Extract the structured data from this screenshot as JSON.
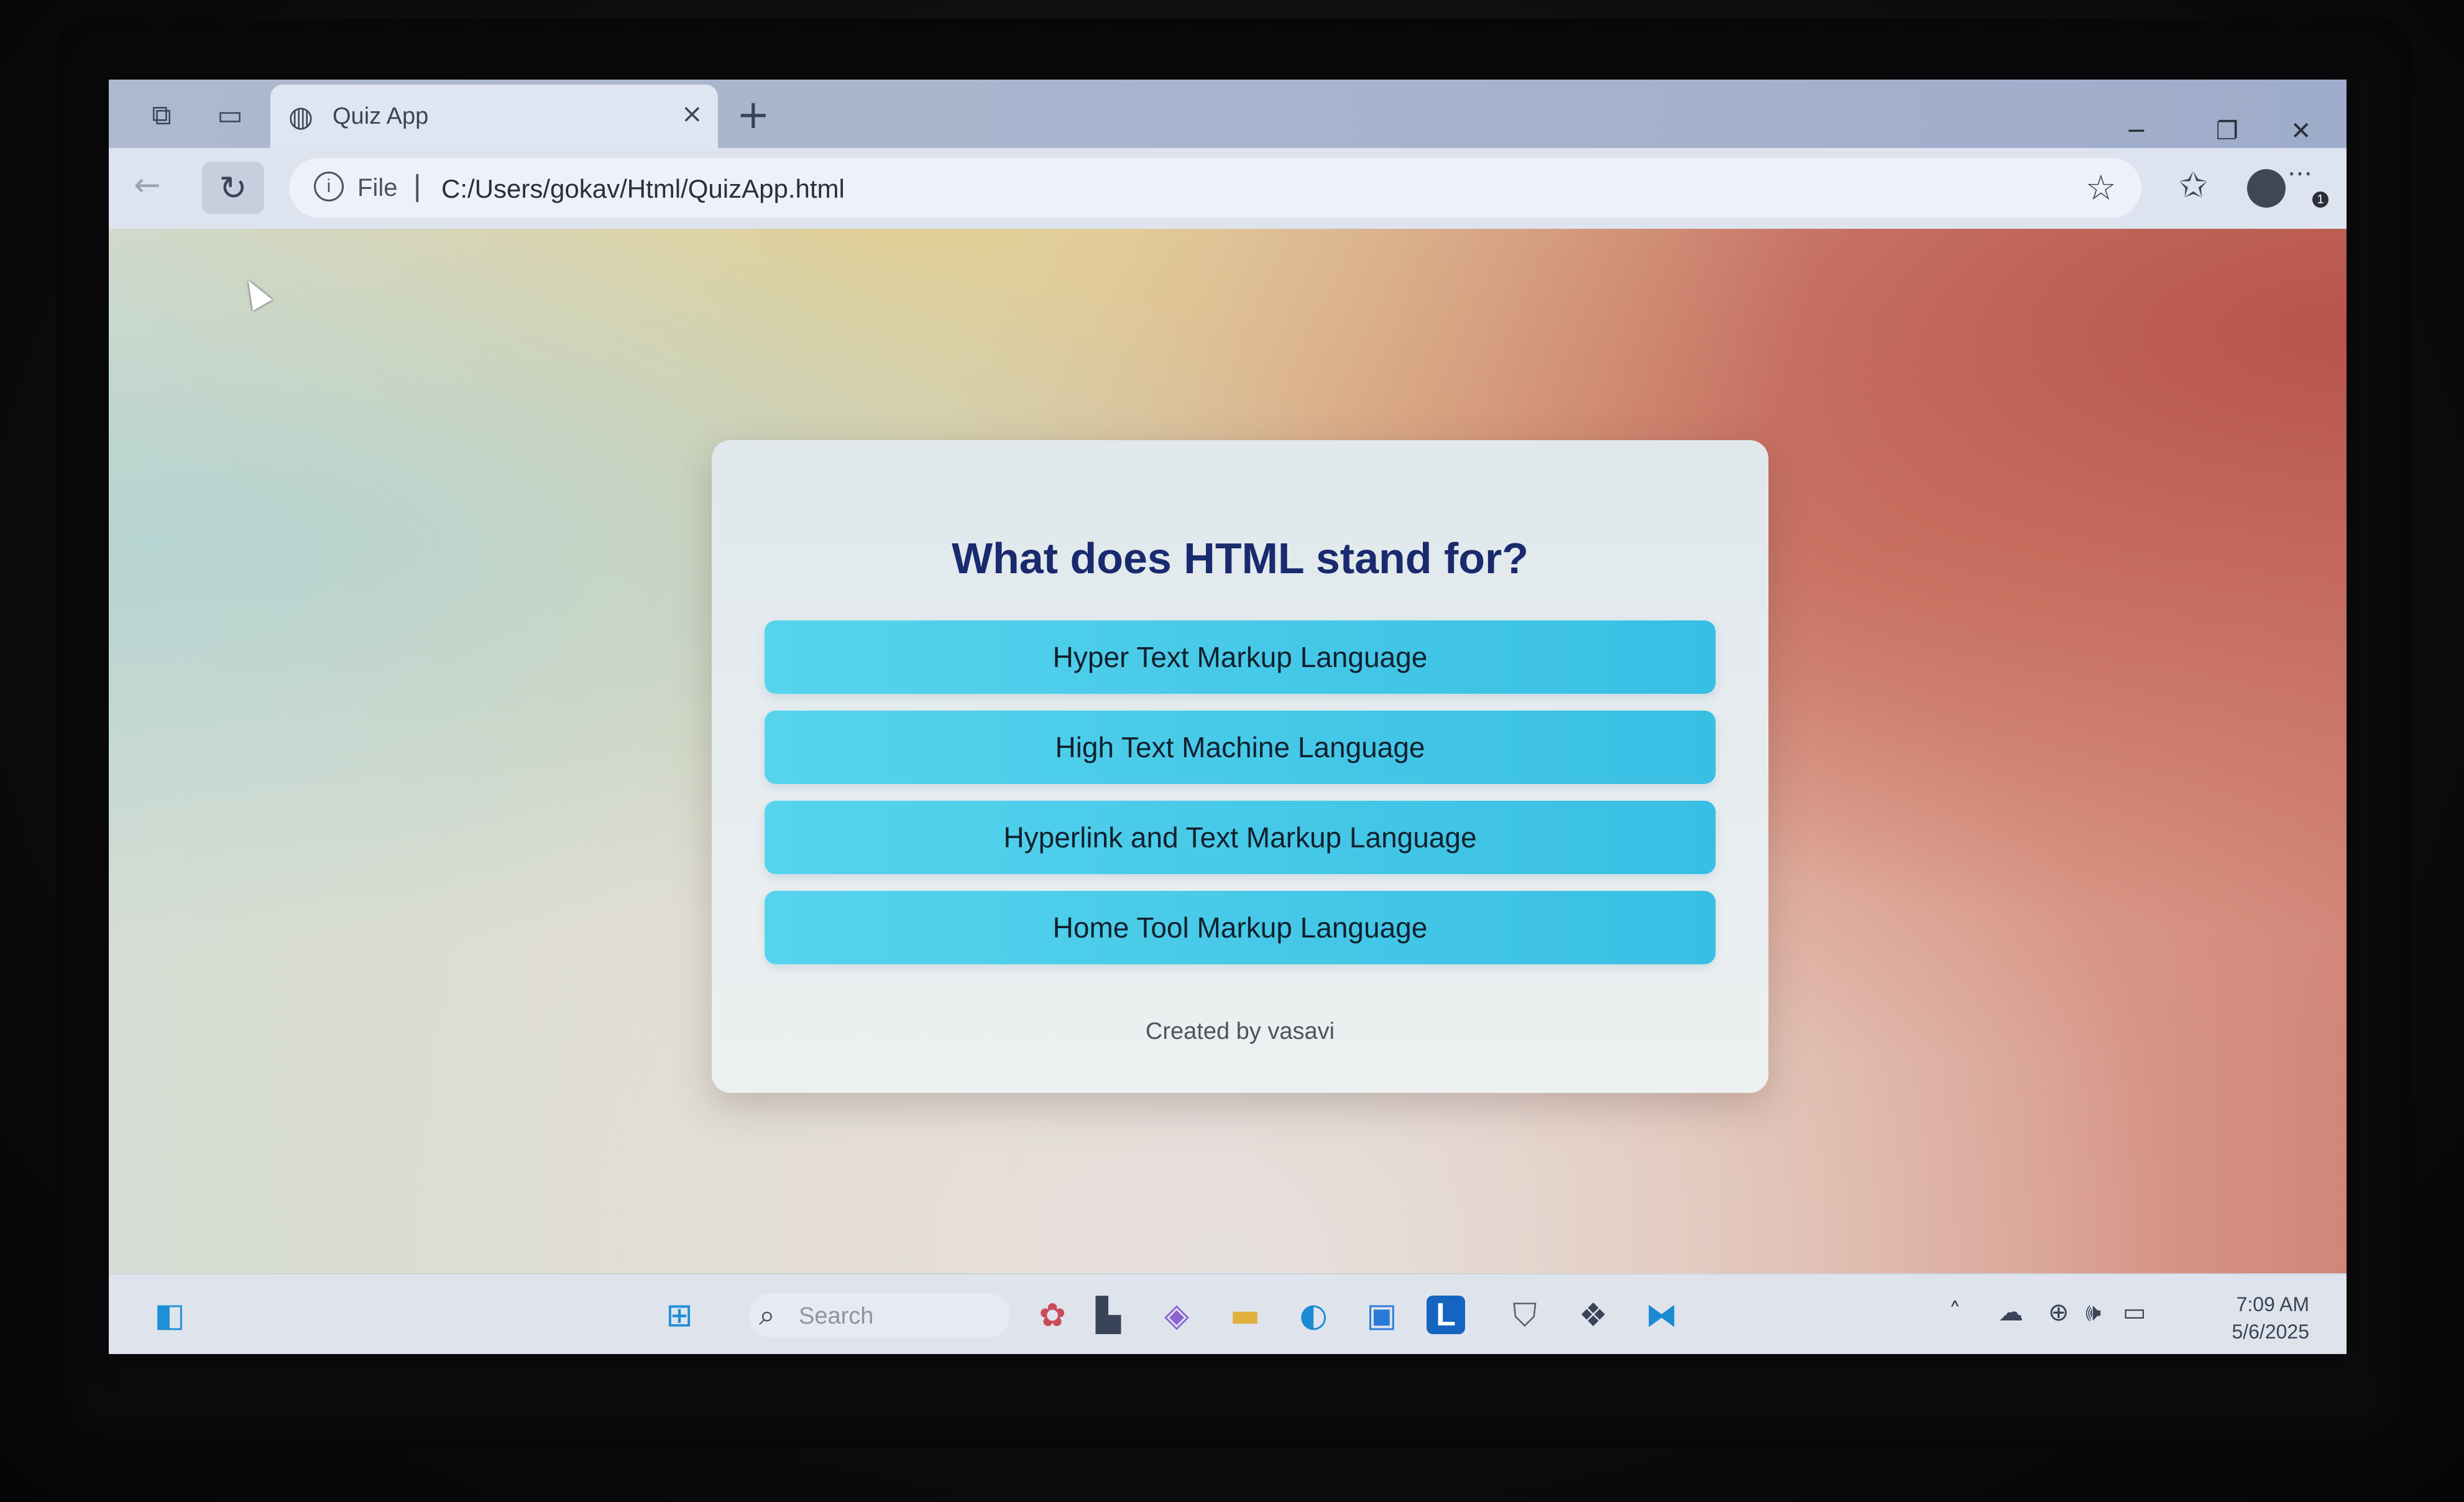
{
  "browser": {
    "tab_title": "Quiz App",
    "new_tab_symbol": "+",
    "tab_close_symbol": "×",
    "address": {
      "scheme_label": "File",
      "url": "C:/Users/gokav/Html/QuizApp.html"
    },
    "window_controls": {
      "minimize": "─",
      "restore": "❐",
      "close": "✕"
    },
    "notification_badge": "1"
  },
  "quiz": {
    "question": "What does HTML stand for?",
    "answers": [
      "Hyper Text Markup Language",
      "High Text Machine Language",
      "Hyperlink and Text Markup Language",
      "Home Tool Markup Language"
    ],
    "footer": "Created by vasavi"
  },
  "taskbar": {
    "search_placeholder": "Search",
    "time": "7:09 AM",
    "date": "5/6/2025",
    "pinned_apps": [
      "widgets-icon",
      "start-icon",
      "search-icon",
      "stickers-icon",
      "task-view-icon",
      "copilot-icon",
      "file-explorer-icon",
      "edge-icon",
      "store-icon",
      "linkedin-icon",
      "mcafee-icon",
      "dropbox-icon",
      "vscode-icon"
    ]
  },
  "colors": {
    "question_text": "#1a2a6e",
    "answer_button": "#38bfe4",
    "card_background": "#e8eef0"
  }
}
